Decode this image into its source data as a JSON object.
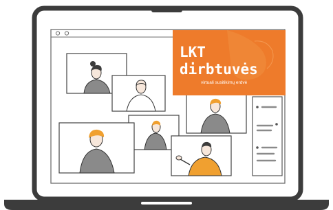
{
  "colors": {
    "laptop_frame": "#3c3c3c",
    "screen_bg": "#ffffff",
    "banner_bg": "#ee7b2b",
    "banner_text": "#ffffff",
    "accent_orange": "#f0a030",
    "skin": "#f7e7db",
    "shirt_gray": "#8a8a8a"
  },
  "banner": {
    "title_line1": "LKT",
    "title_line2": "dirbtuvės",
    "subtitle": "virtuali susitikimų erdvė"
  },
  "icons": {
    "window_controls": "window-dot-icon",
    "participants": "person-icon",
    "sidebar": "list-item-icon"
  }
}
